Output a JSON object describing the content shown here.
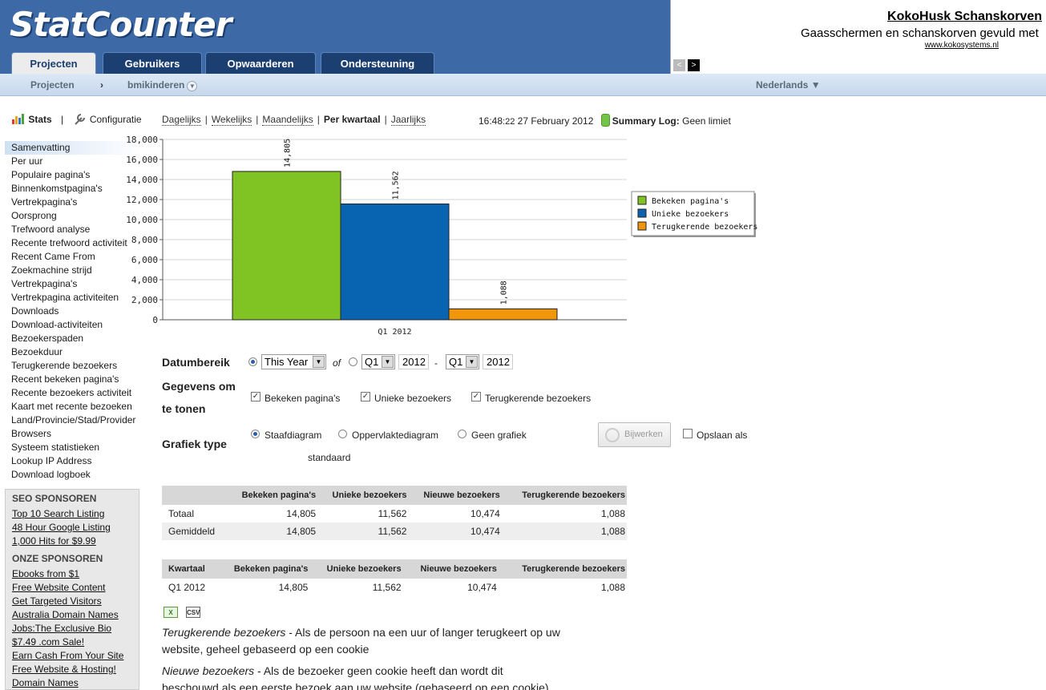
{
  "header": {
    "logo": "StatCounter",
    "tabs": [
      "Projecten",
      "Gebruikers",
      "Opwaarderen",
      "Ondersteuning"
    ],
    "active_tab": "Projecten"
  },
  "ad": {
    "title": "KokoHusk Schanskorven",
    "text": "Gaasschermen en schanskorven gevuld met",
    "url": "www.kokosystems.nl",
    "prev": "<",
    "next": ">"
  },
  "subnav": {
    "projects": "Projecten",
    "separator": "›",
    "project": "bmikinderen",
    "language": "Nederlands ▼"
  },
  "toolbar": {
    "stats": "Stats",
    "sep": "|",
    "config": "Configuratie"
  },
  "sidebar": {
    "items": [
      "Samenvatting",
      "Per uur",
      "Populaire pagina's",
      "Binnenkomstpagina's",
      "Vertrekpagina's",
      "Oorsprong",
      "Trefwoord analyse",
      "Recente trefwoord activiteit",
      "Recent Came From",
      "Zoekmachine strijd",
      "Vertrekpagina's",
      "Vertrekpagina activiteiten",
      "Downloads",
      "Download-activiteiten",
      "Bezoekerspaden",
      "Bezoekduur",
      "Terugkerende bezoekers",
      "Recent bekeken pagina's",
      "Recente bezoekers activiteit",
      "Kaart met recente bezoeken",
      "Land/Provincie/Stad/Provider",
      "Browsers",
      "Systeem statistieken",
      "Lookup IP Address",
      "Download logboek"
    ]
  },
  "sponsors": {
    "seo_head": "SEO SPONSOREN",
    "seo": [
      "Top 10 Search Listing",
      "48 Hour Google Listing",
      "1,000 Hits for $9.99"
    ],
    "our_head": "ONZE SPONSOREN",
    "ours": [
      "Ebooks from $1",
      "Free Website Content",
      "Get Targeted Visitors",
      "Australia Domain Names",
      "Jobs:The Exclusive Bio",
      "$7.49 .com Sale!",
      "Earn Cash From Your Site",
      "Free Website & Hosting!",
      "Domain Names"
    ]
  },
  "periods": {
    "daily": "Dagelijks",
    "weekly": "Wekelijks",
    "monthly": "Maandelijks",
    "quarterly": "Per kwartaal",
    "yearly": "Jaarlijks",
    "sep": "|"
  },
  "clock": {
    "time": "16:48",
    "seconds": ":22",
    "date": "27 February 2012",
    "log_label": "Summary Log:",
    "log_value": "Geen limiet"
  },
  "chart_data": {
    "type": "bar",
    "categories": [
      "Q1 2012"
    ],
    "series": [
      {
        "name": "Bekeken pagina's",
        "values": [
          14805
        ],
        "label": "14,805",
        "color": "#80c423"
      },
      {
        "name": "Unieke bezoekers",
        "values": [
          11562
        ],
        "label": "11,562",
        "color": "#0864b0"
      },
      {
        "name": "Terugkerende bezoekers",
        "values": [
          1088
        ],
        "label": "1,088",
        "color": "#f0960a"
      }
    ],
    "yticks": [
      "0",
      "2,000",
      "4,000",
      "6,000",
      "8,000",
      "10,000",
      "12,000",
      "14,000",
      "16,000",
      "18,000"
    ],
    "ylim": [
      0,
      18000
    ],
    "grid": true,
    "legend": "right",
    "title": "",
    "xlabel": "",
    "ylabel": ""
  },
  "form": {
    "date_range_label": "Datumbereik",
    "range_select": "This Year",
    "of_label": "of",
    "from_q": "Q1",
    "from_year": "2012",
    "dash": "-",
    "to_q": "Q1",
    "to_year": "2012",
    "data_label_1": "Gegevens om",
    "data_label_2": "te tonen",
    "checks": [
      "Bekeken pagina's",
      "Unieke bezoekers",
      "Terugkerende bezoekers"
    ],
    "graph_type_label": "Grafiek type",
    "graph_types": [
      "Staafdiagram",
      "Oppervlaktediagram",
      "Geen grafiek"
    ],
    "graph_type_sub": "standaard",
    "update_button": "Bijwerken",
    "save_label": "Opslaan als"
  },
  "summary_table": {
    "headers": [
      "",
      "Bekeken pagina's",
      "Unieke bezoekers",
      "Nieuwe bezoekers",
      "Terugkerende bezoekers"
    ],
    "rows": [
      [
        "Totaal",
        "14,805",
        "11,562",
        "10,474",
        "1,088"
      ],
      [
        "Gemiddeld",
        "14,805",
        "11,562",
        "10,474",
        "1,088"
      ]
    ]
  },
  "quarter_table": {
    "headers": [
      "Kwartaal",
      "Bekeken pagina's",
      "Unieke bezoekers",
      "Nieuwe bezoekers",
      "Terugkerende bezoekers"
    ],
    "rows": [
      [
        "Q1 2012",
        "14,805",
        "11,562",
        "10,474",
        "1,088"
      ]
    ]
  },
  "export": {
    "excel": "X",
    "csv": "CSV"
  },
  "notes": {
    "term1": "Terugkerende bezoekers",
    "def1": " - Als de persoon na een uur of langer terugkeert op uw website, geheel gebaseerd op een cookie",
    "term2": "Nieuwe bezoekers",
    "def2": " - Als de bezoeker geen cookie heeft dan wordt dit beschouwd als een eerste bezoek aan uw website (gebaseerd op een cookie)"
  }
}
